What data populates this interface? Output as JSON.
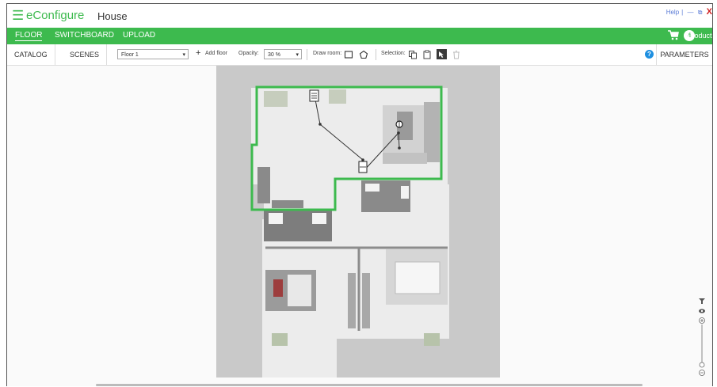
{
  "titlebar": {
    "app_name": "eConfigure",
    "project_name": "House",
    "help": "Help",
    "minimize": "—",
    "close": "X"
  },
  "nav": {
    "tabs": [
      {
        "label": "FLOOR",
        "active": true
      },
      {
        "label": "SWITCHBOARD",
        "active": false
      },
      {
        "label": "UPLOAD",
        "active": false
      }
    ],
    "cart_count": "4",
    "products_label": "Products"
  },
  "toolbar": {
    "catalog_label": "CATALOG",
    "scenes_label": "SCENES",
    "floor_select_value": "Floor 1",
    "add_floor_label": "Add floor",
    "opacity_label": "Opacity:",
    "opacity_value": "30 %",
    "draw_room_label": "Draw room:",
    "selection_label": "Selection:",
    "parameters_label": "PARAMETERS"
  },
  "colors": {
    "brand_green": "#3dba4e",
    "help_blue": "#1e8fe0",
    "close_red": "#d02020"
  },
  "icons": [
    "menu-icon",
    "cart-icon",
    "help-icon",
    "rect-draw-icon",
    "polygon-draw-icon",
    "copy-icon",
    "paste-icon",
    "select-active-icon",
    "trash-icon",
    "pan-icon",
    "eye-icon",
    "zoom-in-icon",
    "zoom-out-icon"
  ]
}
